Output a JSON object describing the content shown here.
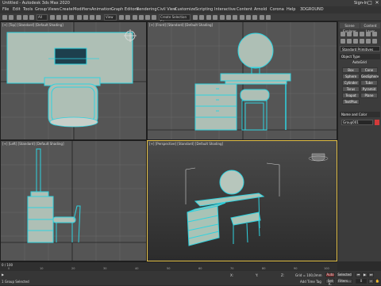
{
  "app": {
    "title": "Untitled - Autodesk 3ds Max 2020",
    "sign_in": "Sign In"
  },
  "window_controls": [
    "–",
    "□",
    "✕"
  ],
  "menu": [
    "File",
    "Edit",
    "Tools",
    "Group",
    "Views",
    "Create",
    "Modifiers",
    "Animation",
    "Graph Editors",
    "Rendering",
    "Civil View",
    "Customize",
    "Scripting",
    "Interactive",
    "Content",
    "Arnold",
    "Corona",
    "Help",
    "3DGROUND"
  ],
  "toolbar": {
    "filter": "All",
    "view_dropdown": "View",
    "create_selection_set": "Create Selection Se"
  },
  "viewports": {
    "top": {
      "label": "[+] [Top] [Standard] [Default Shading]"
    },
    "front": {
      "label": "[+] [Front] [Standard] [Default Shading]"
    },
    "left": {
      "label": "[+] [Left] [Standard] [Default Shading]"
    },
    "perspective": {
      "label": "[+] [Perspective] [Standard] [Default Shading]"
    }
  },
  "command_panel": {
    "tabs": [
      "Scene Explorer",
      "Content Layer"
    ],
    "dropdown": "Standard Primitives",
    "object_type_title": "Object Type",
    "auto_grid": "AutoGrid",
    "buttons": [
      "Box",
      "Cone",
      "Sphere",
      "GeoSphere",
      "Cylinder",
      "Tube",
      "Torus",
      "Pyramid",
      "Teapot",
      "Plane",
      "TextPlus"
    ],
    "name_color_title": "Name and Color",
    "object_name": "Group001",
    "swatch_color": "#d33a3a",
    "icons": [
      "create-icon",
      "modify-icon",
      "hierarchy-icon",
      "motion-icon",
      "display-icon",
      "utilities-icon"
    ]
  },
  "timeline": {
    "frame": "0 / 100",
    "ticks": [
      "0",
      "10",
      "20",
      "30",
      "40",
      "50",
      "60",
      "70",
      "80",
      "90",
      "100"
    ]
  },
  "status": {
    "selection": "1 Group Selected",
    "x": "X:",
    "y": "Y:",
    "z": "Z:",
    "grid": "Grid = 100,0mm",
    "add_time_tag": "Add Time Tag",
    "auto_key": "Auto",
    "selected": "Selected",
    "set_key": "Set K.",
    "filters": "Filters...",
    "frame_value": "0"
  },
  "colors": {
    "wire": "#2fd3e0",
    "mesh": "#a9c3b6",
    "viewport_bg": "#555555",
    "active_border": "#e6c34a"
  }
}
